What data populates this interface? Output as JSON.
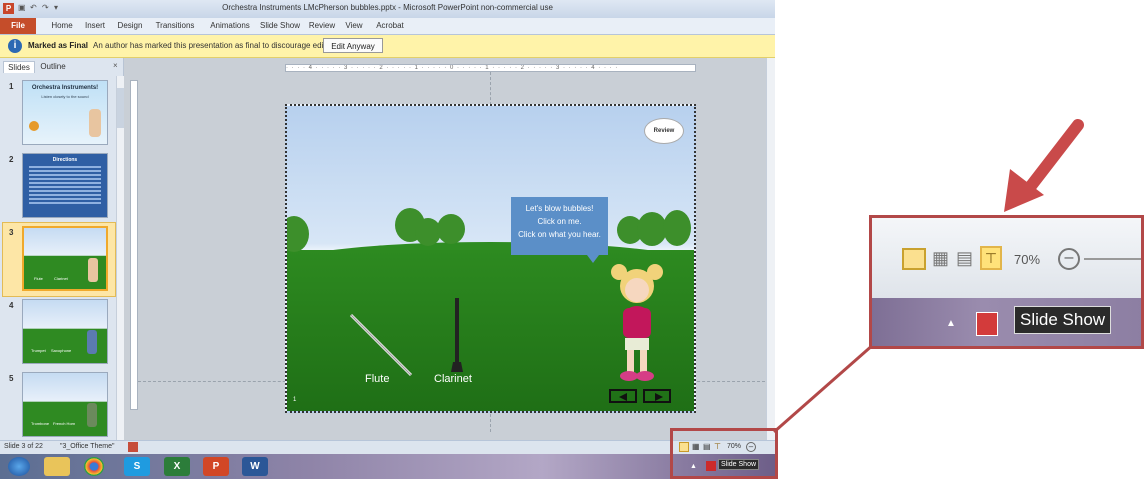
{
  "window": {
    "title": "Orchestra Instruments LMcPherson bubbles.pptx - Microsoft PowerPoint non-commercial use"
  },
  "ribbon": {
    "tabs": [
      "File",
      "Home",
      "Insert",
      "Design",
      "Transitions",
      "Animations",
      "Slide Show",
      "Review",
      "View",
      "Acrobat"
    ]
  },
  "infobar": {
    "bold_label": "Marked as Final",
    "message": "An author has marked this presentation as final to discourage editing.",
    "button_label": "Edit Anyway"
  },
  "panel": {
    "tabs": [
      "Slides",
      "Outline"
    ],
    "close_glyph": "×",
    "thumbnails": [
      {
        "number": "1",
        "title": "Orchestra Instruments!",
        "subtitle": "Listen closely to the sound"
      },
      {
        "number": "2",
        "title": "Directions"
      },
      {
        "number": "3",
        "captions": [
          "Flute",
          "Clarinet"
        ]
      },
      {
        "number": "4",
        "captions": [
          "Trumpet",
          "Saxophone"
        ]
      },
      {
        "number": "5",
        "captions": [
          "Trombone",
          "French Horn"
        ]
      }
    ]
  },
  "ruler": {
    "marks": "· · · · 4 · · · · · 3 · · · · · 2 · · · · · 1 · · · · · 0 · · · · · 1 · · · · · 2 · · · · · 3 · · · · · 4 · · · ·"
  },
  "slide": {
    "review_label": "Review",
    "bubble_lines": [
      "Let's blow bubbles!",
      "Click on me.",
      "Click on what you hear."
    ],
    "instruments": [
      "Flute",
      "Clarinet"
    ],
    "slide_number": "1"
  },
  "statusbar": {
    "slide_counter": "Slide 3 of 22",
    "theme": "\"3_Office Theme\"",
    "zoom": "70%"
  },
  "taskbar": {
    "tooltip": "Slide Show",
    "apps": [
      "start",
      "file-explorer",
      "chrome",
      "skype",
      "excel",
      "powerpoint",
      "word"
    ]
  },
  "zoom_callout": {
    "zoom_value": "70%",
    "tooltip": "Slide Show"
  },
  "annotation": {
    "color": "#b24848"
  }
}
